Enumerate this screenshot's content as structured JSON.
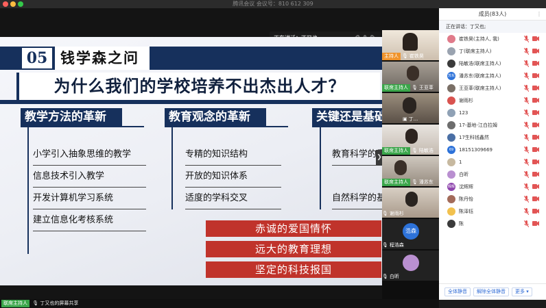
{
  "window": {
    "title": "腾讯会议 会议号：810 612 309"
  },
  "speaking_popup": "正在讲话：丁又也;",
  "slide": {
    "section_number": "05",
    "section_title": "钱学森之问",
    "question": "为什么我们的学校培养不出杰出人才？",
    "columns": [
      {
        "header": "教学方法的革新",
        "items": [
          "小学引入抽象思维的教学",
          "信息技术引入教学",
          "开发计算机学习系统",
          "建立信息化考核系统"
        ]
      },
      {
        "header": "教育观念的革新",
        "items": [
          "专精的知识结构",
          "开放的知识体系",
          "适度的学科交叉"
        ]
      },
      {
        "header": "关键还是基础",
        "items": [
          "教育科学的重",
          "自然科学的基"
        ]
      }
    ],
    "red_bars": [
      "赤诚的爱国情怀",
      "远大的教育理想",
      "坚定的科技报国"
    ]
  },
  "bottom_bar": {
    "tag": "联席主持人",
    "text": "丁又也的屏幕共享"
  },
  "thumbnails": [
    {
      "tag": "主持人",
      "tag_color": "orange",
      "name": "崔铁昊"
    },
    {
      "tag": "联席主持人",
      "tag_color": "green",
      "name": "王亚莘"
    },
    {
      "tag": "",
      "tag_color": "",
      "name": "丁..."
    },
    {
      "tag": "联席主持人",
      "tag_color": "green",
      "name": "陆敏浩"
    },
    {
      "tag": "联席主持人",
      "tag_color": "green",
      "name": "潘苏东"
    },
    {
      "tag": "",
      "tag_color": "",
      "name": "谢雨杉"
    },
    {
      "tag": "",
      "tag_color": "",
      "name": "程浩森",
      "avatar_text": "浩森"
    },
    {
      "tag": "",
      "tag_color": "",
      "name": "白昕"
    }
  ],
  "members_panel": {
    "title": "成员(83人)",
    "speaking": "正在讲话：丁又也;",
    "members": [
      {
        "name": "崔铁昊(主持人, 我)",
        "avatar_color": "#e07a8a",
        "avatar_text": ""
      },
      {
        "name": "丁(联席主持人)",
        "avatar_color": "#9aa3b0",
        "avatar_text": ""
      },
      {
        "name": "陆敏浩(联席主持人)",
        "avatar_color": "#3b3b3b",
        "avatar_text": ""
      },
      {
        "name": "潘苏东(联席主持人)",
        "avatar_color": "#2d72d9",
        "avatar_text": "苏东"
      },
      {
        "name": "王亚莘(联席主持人)",
        "avatar_color": "#7a6f66",
        "avatar_text": ""
      },
      {
        "name": "谢雨杉",
        "avatar_color": "#d9534f",
        "avatar_text": ""
      },
      {
        "name": "123",
        "avatar_color": "#8fa1b5",
        "avatar_text": ""
      },
      {
        "name": "17-基地-江白拉姆",
        "avatar_color": "#6d6d6d",
        "avatar_text": ""
      },
      {
        "name": "17生科钱鑫然",
        "avatar_color": "#4a6fa5",
        "avatar_text": ""
      },
      {
        "name": "18151309669",
        "avatar_color": "#2d72d9",
        "avatar_text": "69"
      },
      {
        "name": "1",
        "avatar_color": "#c7b9a0",
        "avatar_text": ""
      },
      {
        "name": "白昕",
        "avatar_color": "#b98fd0",
        "avatar_text": ""
      },
      {
        "name": "沈辉辉",
        "avatar_color": "#8e44ad",
        "avatar_text": "辉辉"
      },
      {
        "name": "陈丹怡",
        "avatar_color": "#a36b5a",
        "avatar_text": ""
      },
      {
        "name": "陈泽钰",
        "avatar_color": "#f2c14e",
        "avatar_text": ""
      },
      {
        "name": "陈",
        "avatar_color": "#3b3b3b",
        "avatar_text": ""
      }
    ],
    "footer": {
      "mute_all": "全体静音",
      "unmute_all": "解除全体静音",
      "more": "更多 ▾"
    }
  },
  "colors": {
    "slide_navy": "#16305c",
    "slide_red": "#c0332b",
    "host_tag": "#f0932b",
    "cohost_tag": "#3aa64a",
    "mic_active": "#2f6bd6",
    "mic_muted": "#e25555"
  }
}
